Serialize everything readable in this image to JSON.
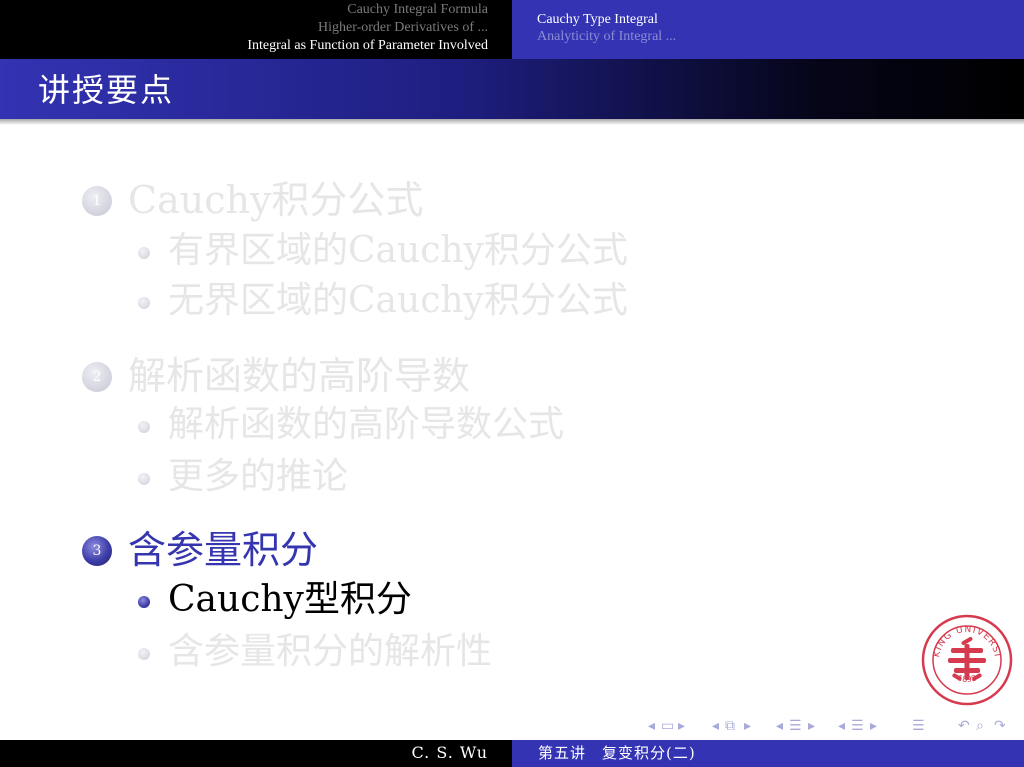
{
  "header": {
    "sections": [
      "Cauchy Integral Formula",
      "Higher-order Derivatives of ...",
      "Integral as Function of Parameter Involved"
    ],
    "subsections": [
      "Cauchy Type Integral",
      "Analyticity of Integral ..."
    ]
  },
  "frame": {
    "title": "讲授要点"
  },
  "outline": {
    "items": [
      {
        "number": "1",
        "label": "Cauchy积分公式",
        "subitems": [
          "有界区域的Cauchy积分公式",
          "无界区域的Cauchy积分公式"
        ]
      },
      {
        "number": "2",
        "label": "解析函数的高阶导数",
        "subitems": [
          "解析函数的高阶导数公式",
          "更多的推论"
        ]
      },
      {
        "number": "3",
        "label": "含参量积分",
        "subitems": [
          "Cauchy型积分",
          "含参量积分的解析性"
        ]
      }
    ],
    "current_item": 3,
    "current_subitem": 1
  },
  "seal": {
    "text": "PEKING UNIVERSITY",
    "year": "1898"
  },
  "footer": {
    "author": "C. S. Wu",
    "short_title": "第五讲　复变积分(二)"
  },
  "colors": {
    "accent": "#3333b3",
    "bar": "#000000",
    "inactive": "#e6e6e6",
    "seal": "#c8102e"
  }
}
